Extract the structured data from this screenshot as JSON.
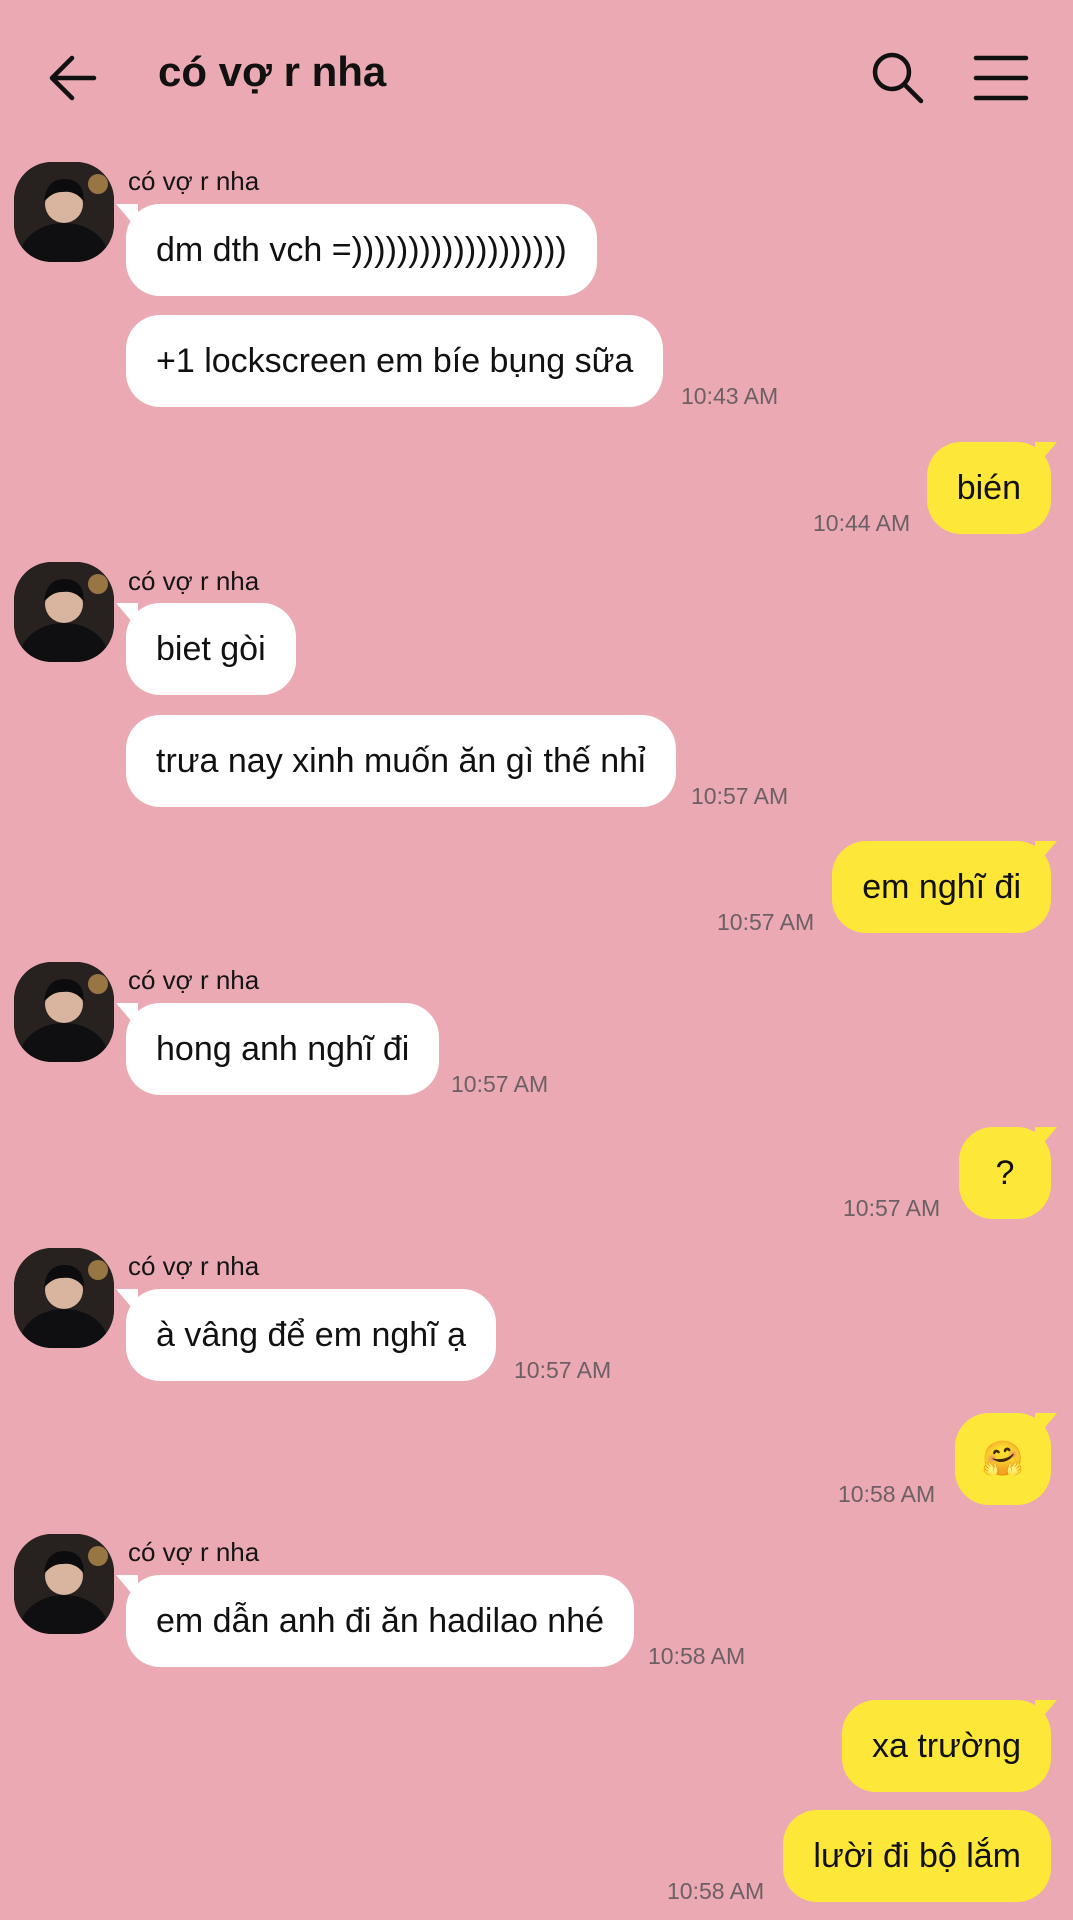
{
  "header": {
    "title": "có vợ r nha"
  },
  "contact": {
    "name": "có vợ r nha"
  },
  "messages": [
    {
      "text": "dm dth vch =)))))))))))))))))))"
    },
    {
      "text": "+1 lockscreen em bíe bụng sữa",
      "time": "10:43 AM"
    },
    {
      "text": "bién",
      "time": "10:44 AM"
    },
    {
      "text": "biet gòi"
    },
    {
      "text": "trưa nay xinh muốn ăn gì thế nhỉ",
      "time": "10:57 AM"
    },
    {
      "text": "em nghĩ đi",
      "time": "10:57 AM"
    },
    {
      "text": "hong anh nghĩ đi",
      "time": "10:57 AM"
    },
    {
      "text": "?",
      "time": "10:57 AM"
    },
    {
      "text": "à vâng để em nghĩ ạ",
      "time": "10:57 AM"
    },
    {
      "text": "🤗",
      "time": "10:58 AM"
    },
    {
      "text": "em dẫn anh đi ăn hadilao nhé",
      "time": "10:58 AM"
    },
    {
      "text": "xa trường"
    },
    {
      "text": "lười đi bộ lắm",
      "time": "10:58 AM"
    }
  ],
  "icons": {
    "back": "arrow-left-icon",
    "search": "search-icon",
    "menu": "hamburger-menu-icon",
    "avatar": "avatar-photo"
  },
  "colors": {
    "background": "#eba9b3",
    "incoming_bubble": "#ffffff",
    "outgoing_bubble": "#fde83a",
    "timestamp": "#6d6065"
  }
}
